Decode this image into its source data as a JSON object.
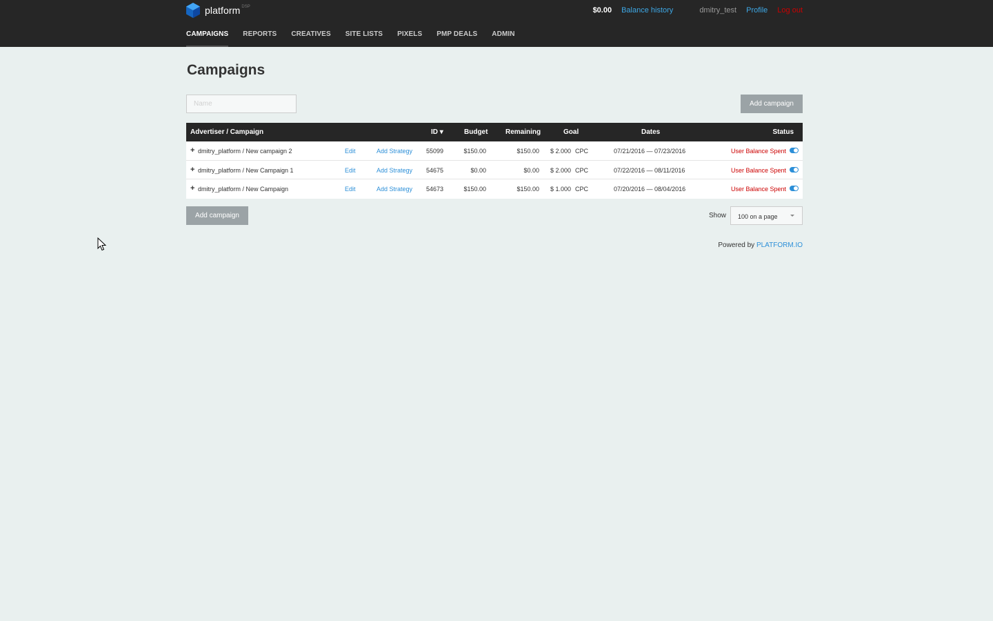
{
  "header": {
    "logo_text": "platform",
    "logo_sup": "DSP",
    "balance": "$0.00",
    "balance_history": "Balance history",
    "username": "dmitry_test",
    "profile": "Profile",
    "logout": "Log out"
  },
  "nav": [
    "CAMPAIGNS",
    "REPORTS",
    "CREATIVES",
    "SITE LISTS",
    "PIXELS",
    "PMP DEALS",
    "ADMIN"
  ],
  "page": {
    "title": "Campaigns",
    "name_placeholder": "Name",
    "add_campaign": "Add campaign"
  },
  "table": {
    "headers": {
      "campaign": "Advertiser / Campaign",
      "id": "ID ▾",
      "budget": "Budget",
      "remaining": "Remaining",
      "goal": "Goal",
      "dates": "Dates",
      "status": "Status"
    },
    "rows": [
      {
        "expand": "+",
        "name": "dmitry_platform / New campaign 2",
        "edit": "Edit",
        "add_strategy": "Add Strategy",
        "id": "55099",
        "budget": "$150.00",
        "remaining": "$150.00",
        "goal": "$ 2.000",
        "goal_type": "CPC",
        "dates": "07/21/2016 — 07/23/2016",
        "status": "User Balance Spent"
      },
      {
        "expand": "+",
        "name": "dmitry_platform / New Campaign 1",
        "edit": "Edit",
        "add_strategy": "Add Strategy",
        "id": "54675",
        "budget": "$0.00",
        "remaining": "$0.00",
        "goal": "$ 2.000",
        "goal_type": "CPC",
        "dates": "07/22/2016 — 08/11/2016",
        "status": "User Balance Spent"
      },
      {
        "expand": "+",
        "name": "dmitry_platform / New Campaign",
        "edit": "Edit",
        "add_strategy": "Add Strategy",
        "id": "54673",
        "budget": "$150.00",
        "remaining": "$150.00",
        "goal": "$ 1.000",
        "goal_type": "CPC",
        "dates": "07/20/2016 — 08/04/2016",
        "status": "User Balance Spent"
      }
    ]
  },
  "footer": {
    "show_label": "Show",
    "per_page": "100 on a page",
    "powered_by": "Powered by",
    "powered_link": "PLATFORM.IO"
  },
  "colors": {
    "topbar": "#262626",
    "background": "#e9f0ef",
    "link": "#2c8fd8",
    "status": "#cc0000"
  }
}
